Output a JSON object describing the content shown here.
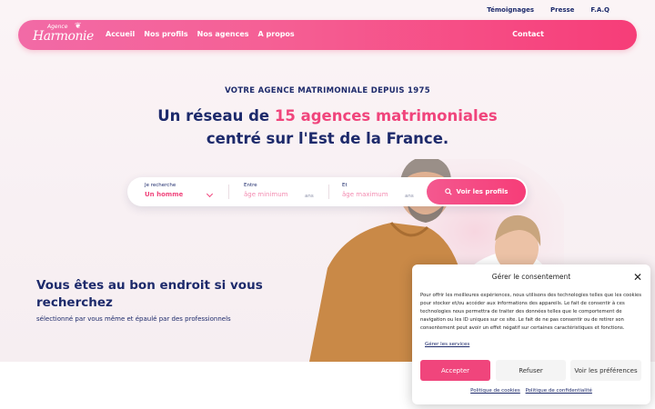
{
  "topbar": {
    "links": [
      "Témoignages",
      "Presse",
      "F.A.Q"
    ]
  },
  "logo": {
    "agence": "Agence",
    "harmonie": "Harmonie"
  },
  "nav": {
    "links": [
      "Accueil",
      "Nos profils",
      "Nos agences",
      "A propos"
    ],
    "contact": "Contact"
  },
  "hero": {
    "kicker": "VOTRE AGENCE MATRIMONIALE DEPUIS 1975",
    "headline_part1": "Un réseau de ",
    "headline_highlight": "15 agences matrimoniales",
    "headline_line2": "centré sur l'Est de la France."
  },
  "search": {
    "field1_label": "Je recherche",
    "field1_value": "Un homme",
    "field2_label": "Entre",
    "field2_placeholder": "âge minimum",
    "field3_label": "Et",
    "field3_placeholder": "âge maximum",
    "unit": "ans",
    "button": "Voir les profils"
  },
  "main": {
    "lead": "Vous êtes au bon endroit si vous recherchez",
    "sub": "sélectionné par vous même et épaulé par des professionnels"
  },
  "consent": {
    "title": "Gérer le consentement",
    "text": "Pour offrir les meilleures expériences, nous utilisons des technologies telles que les cookies pour stocker et/ou accéder aux informations des appareils. Le fait de consentir à ces technologies nous permettra de traiter des données telles que le comportement de navigation ou les ID uniques sur ce site. Le fait de ne pas consentir ou de retirer son consentement peut avoir un effet négatif sur certaines caractéristiques et fonctions.",
    "manage": "Gérer les services",
    "accept": "Accepter",
    "refuse": "Refuser",
    "prefs": "Voir les préférences",
    "cookie_policy": "Politique de cookies",
    "privacy_policy": "Politique de confidentialité"
  },
  "colors": {
    "brand_pink": "#f0457c",
    "navy": "#1d2a6b"
  }
}
